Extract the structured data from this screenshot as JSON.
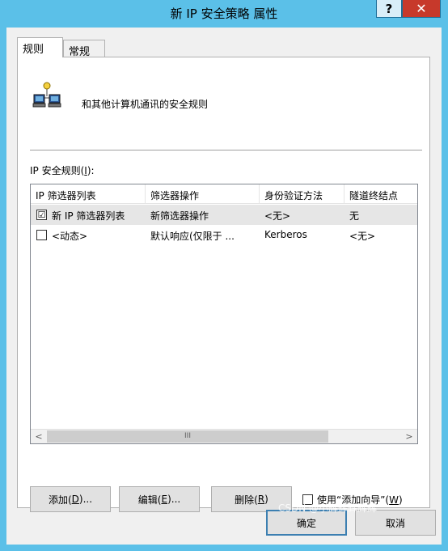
{
  "window": {
    "title": "新 IP 安全策略 属性",
    "help_label": "?",
    "close_label": "✕"
  },
  "tabs": [
    {
      "label": "规则",
      "active": true
    },
    {
      "label": "常规",
      "active": false
    }
  ],
  "rules_tab": {
    "icon": "network-computers-icon",
    "description": "和其他计算机通讯的安全规则",
    "list_label_prefix": "IP 安全规则(",
    "list_label_key": "I",
    "list_label_suffix": "):",
    "columns": [
      "IP 筛选器列表",
      "筛选器操作",
      "身份验证方法",
      "隧道终结点"
    ],
    "rows": [
      {
        "checked": true,
        "check_glyph": "☑",
        "filter_list": "新 IP 筛选器列表",
        "filter_action": "新筛选器操作",
        "auth": "<无>",
        "tunnel": "无"
      },
      {
        "checked": false,
        "check_glyph": "",
        "filter_list": "<动态>",
        "filter_action": "默认响应(仅限于 ...",
        "auth": "Kerberos",
        "tunnel": "<无>"
      }
    ],
    "scroll_left": "<",
    "scroll_right": ">",
    "scroll_grip": "III",
    "buttons": {
      "add": {
        "prefix": "添加(",
        "key": "D",
        "suffix": ")..."
      },
      "edit": {
        "prefix": "编辑(",
        "key": "E",
        "suffix": ")..."
      },
      "delete": {
        "prefix": "删除(",
        "key": "R",
        "suffix": ")"
      }
    },
    "wizard": {
      "prefix": "使用“添加向导”(",
      "key": "W",
      "suffix": ")",
      "checked": false
    }
  },
  "footer": {
    "ok_label": "确定",
    "cancel_label": "取消"
  },
  "watermark": "CSDN @小辉辉辉辉辉"
}
